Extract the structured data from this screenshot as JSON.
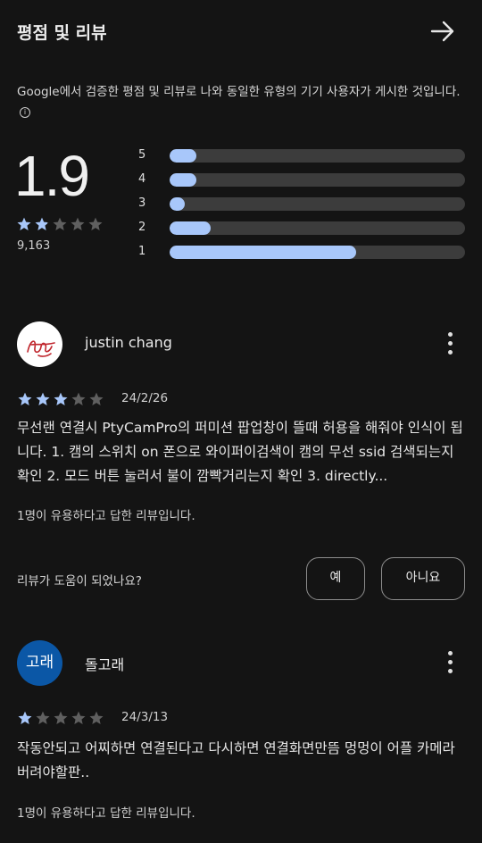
{
  "header": {
    "title": "평점 및 리뷰",
    "forward_icon": "arrow-right-icon"
  },
  "description": "Google에서 검증한 평점 및 리뷰로 나와 동일한 유형의 기기 사용자가 게시한 것입니다.",
  "summary": {
    "rating": "1.9",
    "stars": 1.9,
    "total_reviews": "9,163",
    "distribution": [
      {
        "label": "5",
        "fraction": 0.09
      },
      {
        "label": "4",
        "fraction": 0.09
      },
      {
        "label": "3",
        "fraction": 0.05
      },
      {
        "label": "2",
        "fraction": 0.14
      },
      {
        "label": "1",
        "fraction": 0.63
      }
    ]
  },
  "colors": {
    "accent": "#a8c7fa",
    "star_empty": "#5f5f5f",
    "background": "#141414",
    "avatar2_bg": "#0b57a6"
  },
  "reviews": [
    {
      "name": "justin chang",
      "avatar_kind": "signature",
      "stars": 3,
      "date": "24/2/26",
      "text": "무선랜 연결시 PtyCamPro의 퍼미션 팝업창이 뜰때 허용을 해줘야 인식이 됩니다. 1. 캠의 스위치 on 폰으로 와이퍼이검색이 캠의 무선 ssid 검색되는지 확인 2. 모드 버튼 눌러서 불이 깜빡거리는지 확인 3. directly...",
      "helpful": "1명이 유용하다고 답한 리뷰입니다.",
      "question": "리뷰가 도움이 되었나요?",
      "yes": "예",
      "no": "아니요"
    },
    {
      "name": "돌고래",
      "avatar_text": "고래",
      "stars": 1,
      "date": "24/3/13",
      "text": "작동안되고 어찌하면 연결된다고 다시하면 연결화면만뜸 멍멍이 어플 카메라버려야할판..",
      "helpful": "1명이 유용하다고 답한 리뷰입니다."
    }
  ]
}
